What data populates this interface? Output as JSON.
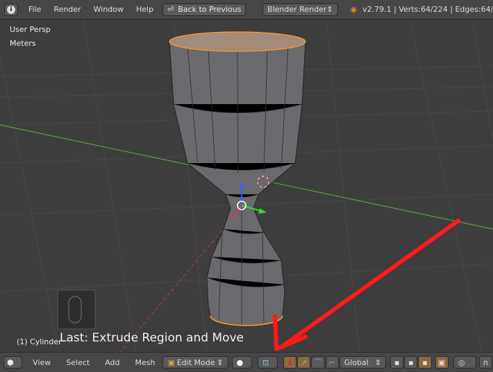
{
  "topbar": {
    "menus": [
      "File",
      "Render",
      "Window",
      "Help"
    ],
    "back_button": "Back to Previous",
    "render_engine": "Blender Render",
    "stats": "v2.79.1 | Verts:64/224 | Edges:64/"
  },
  "viewport": {
    "view_name": "User Persp",
    "units": "Meters",
    "object_label": "(1) Cylinder",
    "last_operator": "Last: Extrude Region and Move"
  },
  "bottombar": {
    "menus": [
      "View",
      "Select",
      "Add",
      "Mesh"
    ],
    "mode": "Edit Mode",
    "orientation": "Global"
  },
  "colors": {
    "annotation_arrow": "#ff1a1a",
    "selection": "#ff9a2a",
    "x_axis": "#c83c3c",
    "y_axis": "#5ab43c",
    "active_button": "#8b6a3a"
  }
}
